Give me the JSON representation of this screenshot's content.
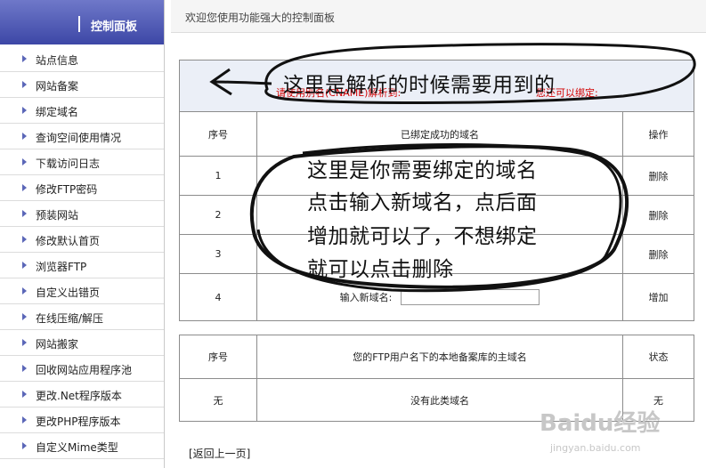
{
  "sidebar": {
    "title": "控制面板",
    "items": [
      {
        "label": "站点信息"
      },
      {
        "label": "网站备案"
      },
      {
        "label": "绑定域名"
      },
      {
        "label": "查询空间使用情况"
      },
      {
        "label": "下载访问日志"
      },
      {
        "label": "修改FTP密码"
      },
      {
        "label": "预装网站"
      },
      {
        "label": "修改默认首页"
      },
      {
        "label": "浏览器FTP"
      },
      {
        "label": "自定义出错页"
      },
      {
        "label": "在线压缩/解压"
      },
      {
        "label": "网站搬家"
      },
      {
        "label": "回收网站应用程序池"
      },
      {
        "label": "更改.Net程序版本"
      },
      {
        "label": "更改PHP程序版本"
      },
      {
        "label": "自定义Mime类型"
      }
    ]
  },
  "topbar": {
    "welcome": "欢迎您使用功能强大的控制面板"
  },
  "bind_table": {
    "info_left": "请使用别名(CNAME)解析到:",
    "info_right": "您还可以绑定:",
    "headers": {
      "index": "序号",
      "domain": "已绑定成功的域名",
      "action": "操作"
    },
    "rows": [
      {
        "index": "1",
        "action": "删除"
      },
      {
        "index": "2",
        "action": "删除"
      },
      {
        "index": "3",
        "action": "删除"
      }
    ],
    "new_row": {
      "index": "4",
      "label": "输入新域名:",
      "action": "增加"
    }
  },
  "record_table": {
    "headers": {
      "index": "序号",
      "domain": "您的FTP用户名下的本地备案库的主域名",
      "status": "状态"
    },
    "row": {
      "index": "无",
      "domain": "没有此类域名",
      "status": "无"
    }
  },
  "back_link": "[返回上一页]",
  "annotations": {
    "top": "这里是解析的时候需要用到的",
    "middle_1": "这里是你需要绑定的域名",
    "middle_2": "点击输入新域名，点后面",
    "middle_3": "增加就可以了，不想绑定",
    "middle_4": "就可以点击删除"
  },
  "watermark": {
    "logo": "Baidu经验",
    "url": "jingyan.baidu.com"
  }
}
